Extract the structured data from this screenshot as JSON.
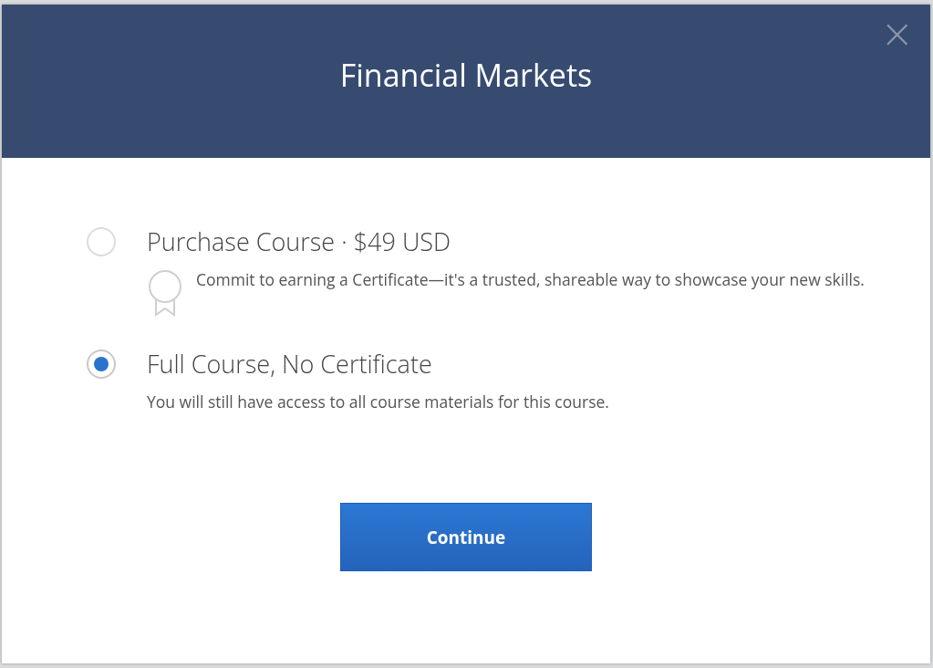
{
  "dialog": {
    "title": "Financial Markets",
    "close": "×"
  },
  "options": [
    {
      "kind": "certificate",
      "label": "Purchase Course · $49 USD",
      "description": "Commit to earning a Certificate—it's a trusted, shareable way to showcase your new skills.",
      "selected": false
    },
    {
      "kind": "plain",
      "label": "Full Course, No Certificate",
      "description": "You will still have access to all course materials for this course.",
      "selected": true
    }
  ],
  "button": "Continue"
}
